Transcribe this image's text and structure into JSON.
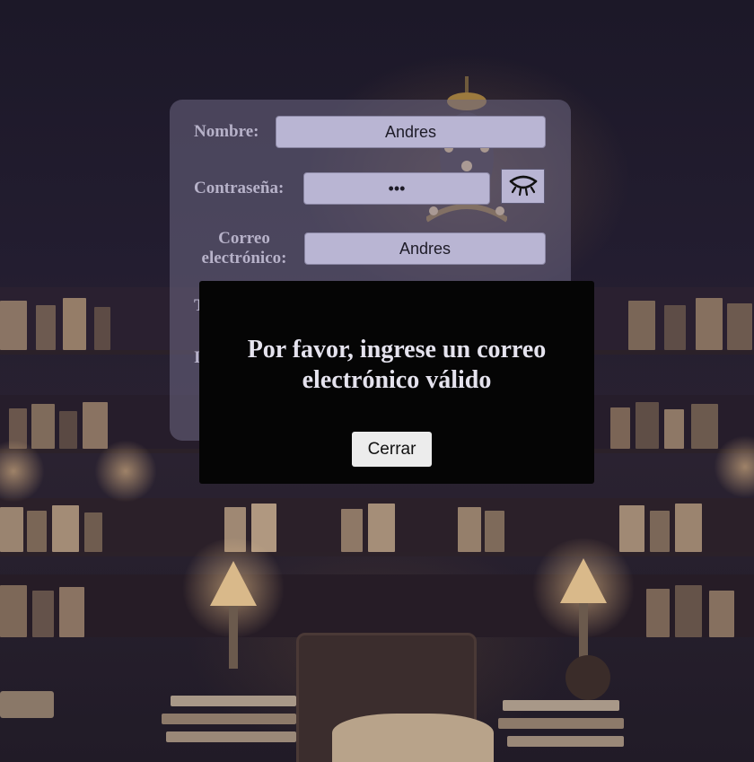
{
  "form": {
    "name_label": "Nombre:",
    "name_value": "Andres",
    "password_label": "Contraseña:",
    "password_value": "•••",
    "password_toggle_icon": "eye-closed-icon",
    "email_label_line1": "Correo",
    "email_label_line2": "electrónico:",
    "email_value": "Andres",
    "partial_label_1": "T",
    "partial_label_2": "I"
  },
  "modal": {
    "message": "Por favor, ingrese un correo electrónico válido",
    "close_label": "Cerrar"
  },
  "colors": {
    "card_bg": "#6e6884",
    "field_bg": "#b9b5d3",
    "modal_bg": "#050505",
    "label_text": "#b7b2c9"
  }
}
